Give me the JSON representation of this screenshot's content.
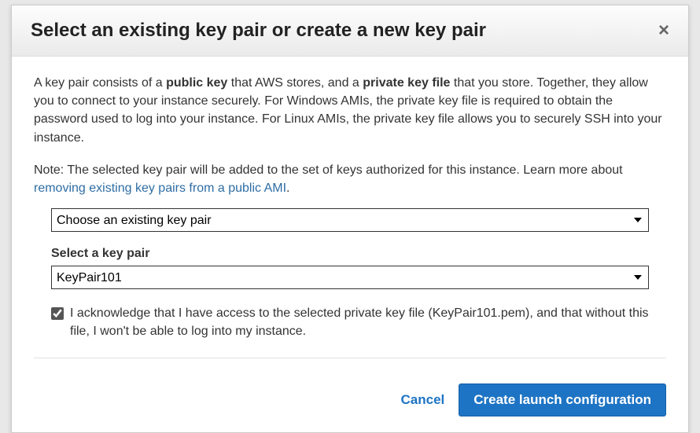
{
  "modal": {
    "title": "Select an existing key pair or create a new key pair",
    "close_label": "×",
    "description": {
      "pre1": "A key pair consists of a ",
      "bold1": "public key",
      "mid1": " that AWS stores, and a ",
      "bold2": "private key file",
      "post1": " that you store. Together, they allow you to connect to your instance securely. For Windows AMIs, the private key file is required to obtain the password used to log into your instance. For Linux AMIs, the private key file allows you to securely SSH into your instance."
    },
    "note": {
      "text": "Note: The selected key pair will be added to the set of keys authorized for this instance. Learn more about ",
      "link": "removing existing key pairs from a public AMI",
      "suffix": "."
    },
    "option_select": {
      "value": "Choose an existing key pair"
    },
    "keypair_label": "Select a key pair",
    "keypair_select": {
      "value": "KeyPair101"
    },
    "ack": {
      "checked": true,
      "text": "I acknowledge that I have access to the selected private key file (KeyPair101.pem), and that without this file, I won't be able to log into my instance."
    },
    "footer": {
      "cancel": "Cancel",
      "primary": "Create launch configuration"
    }
  }
}
